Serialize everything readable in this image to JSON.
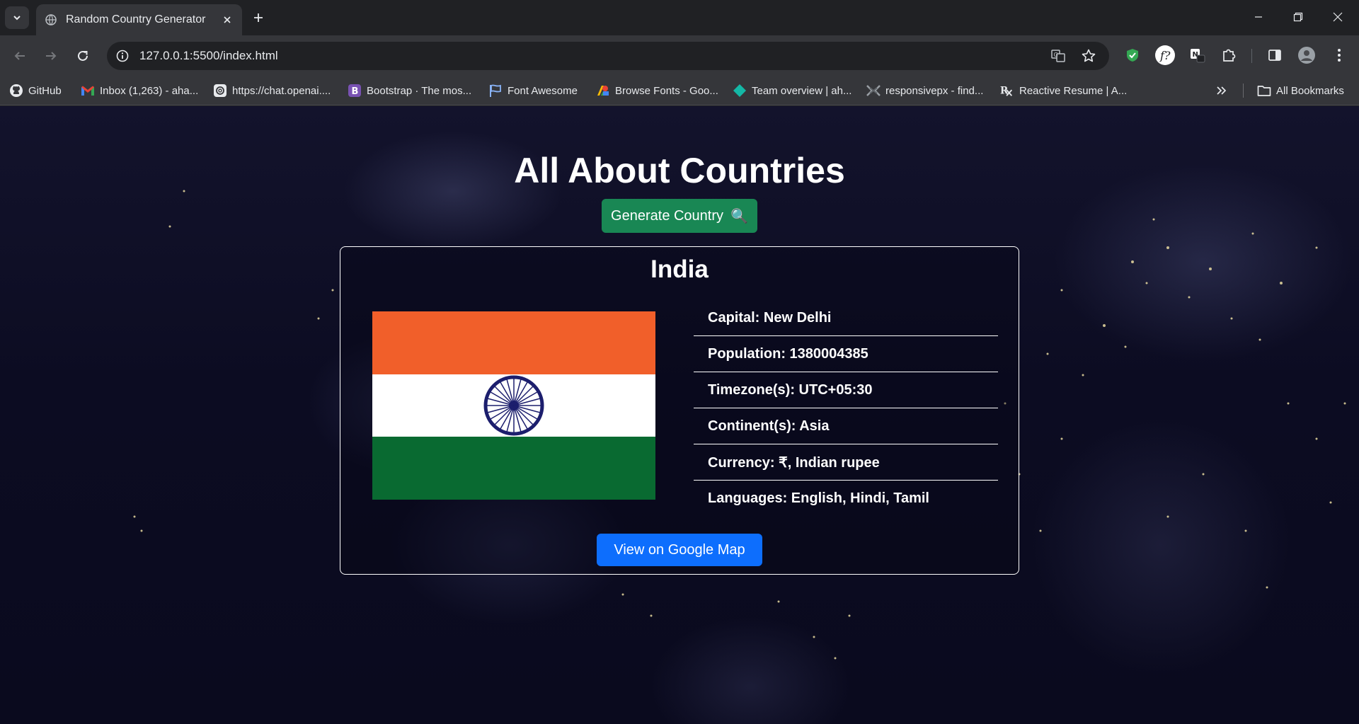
{
  "browser": {
    "tab": {
      "title": "Random Country Generator"
    },
    "url": "127.0.0.1:5500/index.html",
    "bookmarks": [
      {
        "label": "GitHub",
        "icon": "github-icon"
      },
      {
        "label": "Inbox (1,263) - aha...",
        "icon": "gmail-icon"
      },
      {
        "label": "https://chat.openai....",
        "icon": "openai-icon"
      },
      {
        "label": "Bootstrap · The mos...",
        "icon": "bootstrap-icon"
      },
      {
        "label": "Font Awesome",
        "icon": "flag-icon"
      },
      {
        "label": "Browse Fonts - Goo...",
        "icon": "google-fonts-icon"
      },
      {
        "label": "Team overview | ah...",
        "icon": "diamond-icon"
      },
      {
        "label": "responsivepx - find...",
        "icon": "responsivepx-icon"
      },
      {
        "label": "Reactive Resume | A...",
        "icon": "rx-icon"
      }
    ],
    "all_bookmarks": "All Bookmarks"
  },
  "page": {
    "title": "All About Countries",
    "generate_button": "Generate Country",
    "generate_icon": "🔍",
    "country": {
      "name": "India",
      "flag_colors": {
        "saffron": "#f15f2a",
        "white": "#ffffff",
        "green": "#096a31",
        "chakra": "#1c1e6d"
      },
      "details": [
        "Capital: New Delhi",
        "Population: 1380004385",
        "Timezone(s): UTC+05:30",
        "Continent(s): Asia",
        "Currency: ₹, Indian rupee",
        "Languages: English, Hindi, Tamil"
      ]
    },
    "map_button": "View on Google Map"
  }
}
